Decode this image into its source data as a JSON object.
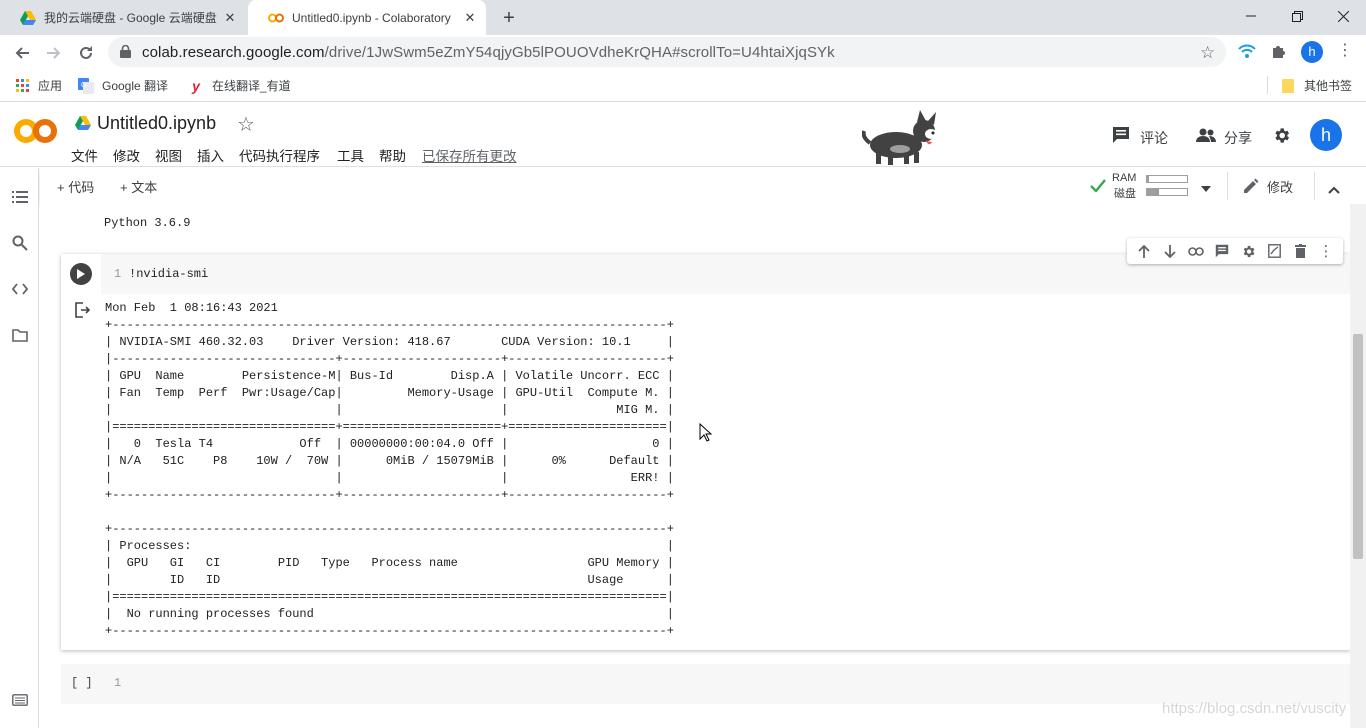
{
  "browser": {
    "tabs": [
      {
        "title": "我的云端硬盘 - Google 云端硬盘",
        "icon": "google-drive-icon",
        "active": false
      },
      {
        "title": "Untitled0.ipynb - Colaboratory",
        "icon": "colab-icon",
        "active": true
      }
    ],
    "new_tab_icon": "plus-icon",
    "url_host": "colab.research.google.com",
    "url_path": "/drive/1JwSwm5eZmY54qjyGb5lPOUOVdheKrQHA#scrollTo=U4htaiXjqSYk",
    "profile_initial": "h",
    "bookmarks": [
      {
        "label": "应用",
        "icon": "apps-grid-icon"
      },
      {
        "label": "Google 翻译",
        "icon": "google-translate-icon"
      },
      {
        "label": "在线翻译_有道",
        "icon": "youdao-icon"
      }
    ],
    "other_bookmarks": "其他书签"
  },
  "colab": {
    "logo_text": "CO",
    "notebook_title": "Untitled0.ipynb",
    "menu": [
      "文件",
      "修改",
      "视图",
      "插入",
      "代码执行程序",
      "工具",
      "帮助"
    ],
    "save_status": "已保存所有更改",
    "comment_label": "评论",
    "share_label": "分享",
    "user_initial": "h",
    "add_code_label": "+ 代码",
    "add_text_label": "+ 文本",
    "ram_label": "RAM",
    "disk_label": "磁盘",
    "ram_fraction": 0.05,
    "disk_fraction": 0.3,
    "edit_label": "修改"
  },
  "notebook": {
    "previous_output": "Python 3.6.9",
    "cell": {
      "line_number": "1",
      "code": "!nvidia-smi",
      "output": "Mon Feb  1 08:16:43 2021\n+-----------------------------------------------------------------------------+\n| NVIDIA-SMI 460.32.03    Driver Version: 418.67       CUDA Version: 10.1     |\n|-------------------------------+----------------------+----------------------+\n| GPU  Name        Persistence-M| Bus-Id        Disp.A | Volatile Uncorr. ECC |\n| Fan  Temp  Perf  Pwr:Usage/Cap|         Memory-Usage | GPU-Util  Compute M. |\n|                               |                      |               MIG M. |\n|===============================+======================+======================|\n|   0  Tesla T4            Off  | 00000000:00:04.0 Off |                    0 |\n| N/A   51C    P8    10W /  70W |      0MiB / 15079MiB |      0%      Default |\n|                               |                      |                 ERR! |\n+-------------------------------+----------------------+----------------------+\n\n+-----------------------------------------------------------------------------+\n| Processes:                                                                  |\n|  GPU   GI   CI        PID   Type   Process name                  GPU Memory |\n|        ID   ID                                                   Usage      |\n|=============================================================================|\n|  No running processes found                                                 |\n+-----------------------------------------------------------------------------+"
    },
    "next_cell": {
      "run_label": "[ ]",
      "line_number": "1"
    }
  },
  "watermark": "https://blog.csdn.net/vuscity"
}
